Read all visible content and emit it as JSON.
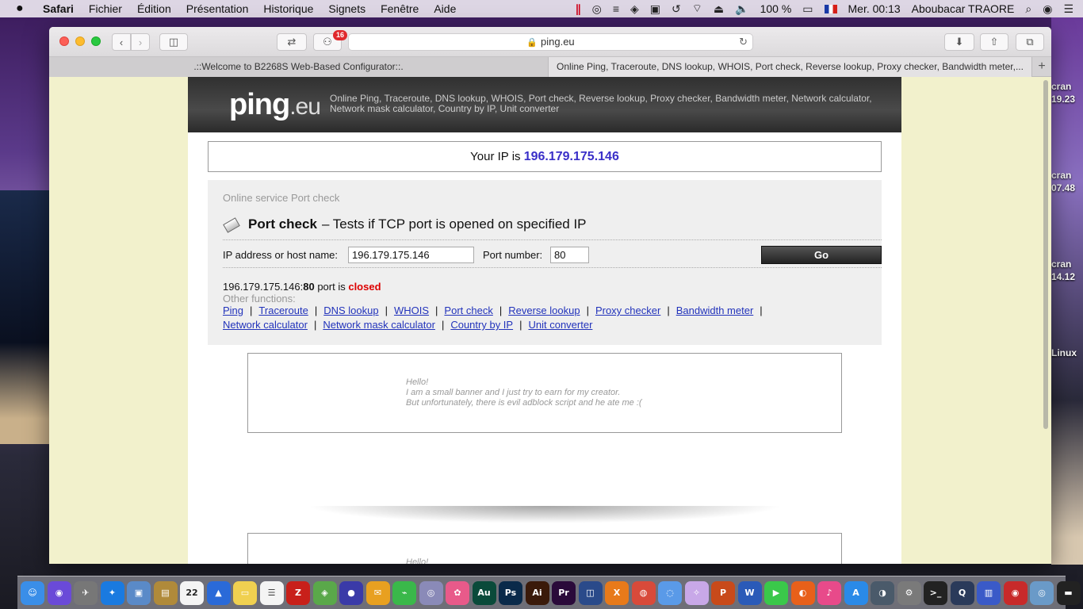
{
  "menubar": {
    "app_name": "Safari",
    "items": [
      "Fichier",
      "Édition",
      "Présentation",
      "Historique",
      "Signets",
      "Fenêtre",
      "Aide"
    ],
    "battery": "100 %",
    "clock": "Mer. 00:13",
    "user": "Aboubacar TRAORE"
  },
  "desktop": {
    "labels": [
      "cran",
      "19.23",
      "cran",
      "07.48",
      "cran",
      "14.12",
      "Linux"
    ]
  },
  "browser": {
    "tab_badge": "16",
    "url": "ping.eu",
    "tabs": [
      {
        "label": ".::Welcome to B2268S Web-Based Configurator::."
      },
      {
        "label": "Online Ping, Traceroute, DNS lookup, WHOIS, Port check, Reverse lookup, Proxy checker, Bandwidth meter,..."
      }
    ]
  },
  "site": {
    "logo_main": "ping",
    "logo_suffix": ".eu",
    "tagline": "Online Ping, Traceroute, DNS lookup, WHOIS, Port check, Reverse lookup, Proxy checker, Bandwidth meter, Network calculator, Network mask calculator, Country by IP, Unit converter",
    "ip_prefix": "Your IP is",
    "ip_value": "196.179.175.146"
  },
  "portcheck": {
    "breadcrumb": "Online service Port check",
    "title_bold": "Port check",
    "title_rest": "– Tests if TCP port is opened on specified IP",
    "host_label": "IP address or host name:",
    "host_value": "196.179.175.146",
    "port_label": "Port number:",
    "port_value": "80",
    "go_label": "Go",
    "result_host": "196.179.175.146:",
    "result_port": "80",
    "result_mid": "port is",
    "result_status": "closed",
    "other_label": "Other functions:",
    "links": [
      "Ping",
      "Traceroute",
      "DNS lookup",
      "WHOIS",
      "Port check",
      "Reverse lookup",
      "Proxy checker",
      "Bandwidth meter",
      "Network calculator",
      "Network mask calculator",
      "Country by IP",
      "Unit converter"
    ]
  },
  "banner": {
    "line1": "Hello!",
    "line2": "I am a small banner and I just try to earn for my creator.",
    "line3": "But unfortunately, there is evil adblock script and he ate me :(",
    "line1_b": "Hello!"
  },
  "dock": {
    "calendar_day": "22",
    "icons": [
      {
        "name": "finder-icon",
        "glyph": "☺",
        "color": "#3a8ee8"
      },
      {
        "name": "siri-icon",
        "glyph": "◉",
        "color": "#6a4ad8"
      },
      {
        "name": "launchpad-icon",
        "glyph": "✈",
        "color": "#777"
      },
      {
        "name": "safari-icon",
        "glyph": "✦",
        "color": "#1a7ae0"
      },
      {
        "name": "preview-icon",
        "glyph": "▣",
        "color": "#5a8ac8"
      },
      {
        "name": "notes-folder-icon",
        "glyph": "▤",
        "color": "#b08a3a"
      },
      {
        "name": "calendar-icon",
        "glyph": "22",
        "color": "#f4f4f4"
      },
      {
        "name": "fin-icon",
        "glyph": "▲",
        "color": "#2a6ad8"
      },
      {
        "name": "notes-icon",
        "glyph": "▭",
        "color": "#f0d050"
      },
      {
        "name": "reminders-icon",
        "glyph": "☰",
        "color": "#f4f4f4"
      },
      {
        "name": "filezilla-icon",
        "glyph": "Z",
        "color": "#c8201a"
      },
      {
        "name": "maps-icon",
        "glyph": "◈",
        "color": "#5aa84a"
      },
      {
        "name": "gitkraken-icon",
        "glyph": "●",
        "color": "#3a3aa8"
      },
      {
        "name": "messages-edit-icon",
        "glyph": "✉",
        "color": "#e8a020"
      },
      {
        "name": "android-icon",
        "glyph": "⌁",
        "color": "#3ab84a"
      },
      {
        "name": "eye-icon",
        "glyph": "◎",
        "color": "#8a8ab8"
      },
      {
        "name": "photos-icon",
        "glyph": "✿",
        "color": "#e85a8a"
      },
      {
        "name": "audition-icon",
        "glyph": "Au",
        "color": "#0a4a3a"
      },
      {
        "name": "photoshop-icon",
        "glyph": "Ps",
        "color": "#0a2a4a"
      },
      {
        "name": "illustrator-icon",
        "glyph": "Ai",
        "color": "#3a1a0a"
      },
      {
        "name": "premiere-icon",
        "glyph": "Pr",
        "color": "#2a0a3a"
      },
      {
        "name": "virtualbox-icon",
        "glyph": "◫",
        "color": "#2a4a8a"
      },
      {
        "name": "xampp-icon",
        "glyph": "X",
        "color": "#e87a1a"
      },
      {
        "name": "chrome-icon",
        "glyph": "◍",
        "color": "#d84a3a"
      },
      {
        "name": "chat-icon",
        "glyph": "◌",
        "color": "#5a9ae8"
      },
      {
        "name": "unicorn-icon",
        "glyph": "✧",
        "color": "#c8a8e8"
      },
      {
        "name": "powerpoint-icon",
        "glyph": "P",
        "color": "#c84a1a"
      },
      {
        "name": "word-icon",
        "glyph": "W",
        "color": "#2a5ab8"
      },
      {
        "name": "facetime-icon",
        "glyph": "▶",
        "color": "#3ac84a"
      },
      {
        "name": "firefox-icon",
        "glyph": "◐",
        "color": "#e8601a"
      },
      {
        "name": "itunes-icon",
        "glyph": "♪",
        "color": "#e84a8a"
      },
      {
        "name": "appstore-icon",
        "glyph": "A",
        "color": "#2a8ae8"
      },
      {
        "name": "network-utility-icon",
        "glyph": "◑",
        "color": "#4a5a6a"
      },
      {
        "name": "system-preferences-icon",
        "glyph": "⚙",
        "color": "#7a7a7a"
      },
      {
        "name": "terminal-icon",
        "glyph": ">_",
        "color": "#222"
      },
      {
        "name": "quicktime-icon",
        "glyph": "Q",
        "color": "#2a3a5a"
      },
      {
        "name": "monitor-icon",
        "glyph": "▥",
        "color": "#3a5ac8"
      },
      {
        "name": "screen-record-icon",
        "glyph": "◉",
        "color": "#c82a2a"
      },
      {
        "name": "eye2-icon",
        "glyph": "◎",
        "color": "#6a9ac8"
      },
      {
        "name": "display-icon",
        "glyph": "▬",
        "color": "#222"
      },
      {
        "name": "downloads-folder-icon",
        "glyph": "↓",
        "color": "#5aa0e8"
      },
      {
        "name": "trash-icon",
        "glyph": "🗑",
        "color": "#c8c8d0"
      }
    ]
  }
}
